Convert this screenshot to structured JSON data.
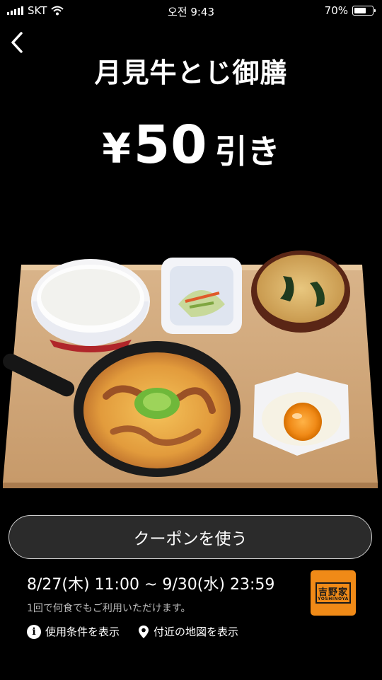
{
  "status": {
    "carrier": "SKT",
    "time": "오전 9:43",
    "battery": "70%",
    "battery_level": 0.7
  },
  "nav": {
    "back_icon": "chevron-left-icon"
  },
  "coupon": {
    "title": "月見牛とじ御膳",
    "discount_currency": "¥",
    "discount_amount": "50",
    "discount_suffix": "引き",
    "button_label": "クーポンを使う",
    "validity": "8/27(木) 11:00 ~ 9/30(水) 23:59",
    "usage_note": "1回で何食でもご利用いただけます。",
    "terms_label": "使用条件を表示",
    "map_label": "付近の地図を表示"
  },
  "brand": {
    "logo_kanji": "吉野家",
    "logo_roman": "YOSHINOYA",
    "logo_color": "#f08a17"
  },
  "icons": {
    "terms": "info-icon",
    "map": "location-pin-icon"
  }
}
